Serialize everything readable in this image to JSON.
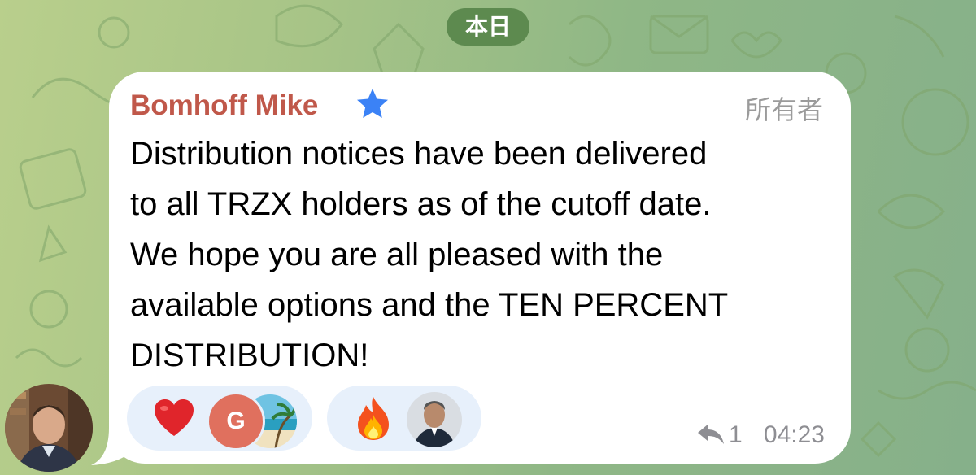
{
  "date_divider": "本日",
  "message": {
    "sender": "Bomhoff Mike",
    "role": "所有者",
    "lines": [
      "Distribution notices have been delivered",
      "to all TRZX holders as of the cutoff date.",
      "We hope you are all pleased with the",
      "available options and the TEN PERCENT",
      "DISTRIBUTION!"
    ],
    "reply_count": "1",
    "time": "04:23",
    "reactions": [
      {
        "icon": "heart-emoji",
        "reactor_initial": "G"
      },
      {
        "icon": "fire-emoji"
      }
    ]
  },
  "colors": {
    "sender": "#c0584a",
    "date_pill": "#5d8a4f",
    "reaction_bg": "#e7f0fb",
    "meta_text": "#8e8e93",
    "star": "#3b82f6"
  }
}
